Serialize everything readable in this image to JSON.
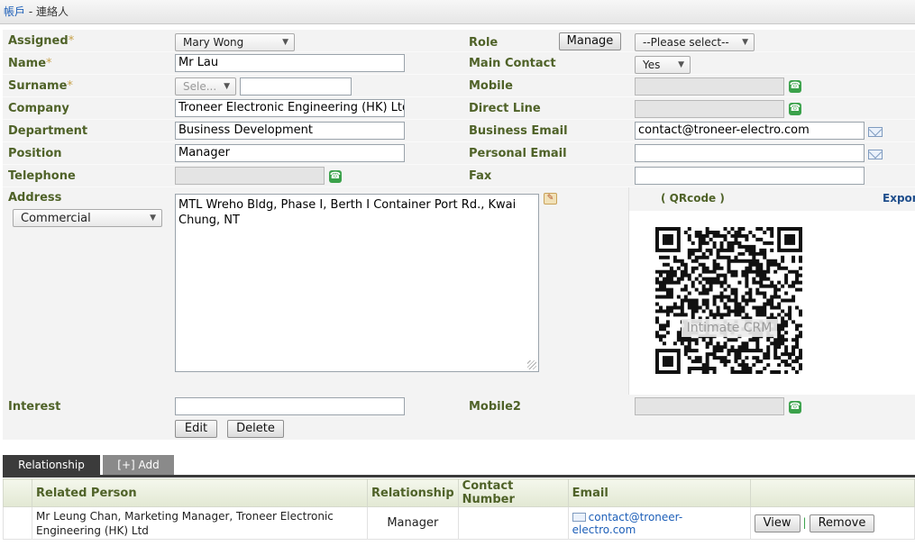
{
  "breadcrumb": {
    "root": "帳戶",
    "separator": " - ",
    "current": "連絡人"
  },
  "form": {
    "assigned": {
      "label": "Assigned",
      "required": "*",
      "value": "Mary Wong"
    },
    "role": {
      "label": "Role",
      "button": "Manage",
      "value": "--Please select--"
    },
    "name": {
      "label": "Name",
      "required": "*",
      "value": "Mr Lau"
    },
    "main_contact": {
      "label": "Main Contact",
      "value": "Yes"
    },
    "surname": {
      "label": "Surname",
      "required": "*",
      "select_value": "Sele...",
      "value": ""
    },
    "mobile": {
      "label": "Mobile",
      "value": ""
    },
    "company": {
      "label": "Company",
      "value": "Troneer Electronic Engineering (HK) Ltd"
    },
    "direct_line": {
      "label": "Direct Line",
      "value": ""
    },
    "department": {
      "label": "Department",
      "value": "Business Development"
    },
    "business_email": {
      "label": "Business Email",
      "value": "contact@troneer-electro.com"
    },
    "position": {
      "label": "Position",
      "value": "Manager"
    },
    "personal_email": {
      "label": "Personal Email",
      "value": ""
    },
    "telephone": {
      "label": "Telephone",
      "value": ""
    },
    "fax": {
      "label": "Fax",
      "value": ""
    },
    "address": {
      "label": "Address",
      "type_value": "Commercial",
      "value": "MTL Wreho Bldg, Phase I, Berth I Container Port Rd., Kwai Chung, NT"
    },
    "interest": {
      "label": "Interest",
      "value": ""
    },
    "mobile2": {
      "label": "Mobile2",
      "value": ""
    },
    "edit_label": "Edit",
    "delete_label": "Delete"
  },
  "qr": {
    "title": "( QRcode )",
    "export_label": "Export",
    "watermark": "Intimate CRM"
  },
  "relationship": {
    "tab_label": "Relationship",
    "add_label": "[+] Add",
    "columns": [
      "Related Person",
      "Relationship",
      "Contact Number",
      "Email"
    ],
    "rows": [
      {
        "person": "Mr Leung Chan, Marketing Manager, Troneer Electronic Engineering (HK) Ltd",
        "relationship": "Manager",
        "contact_number": "",
        "email": "contact@troneer-electro.com",
        "view_label": "View",
        "separator": "|",
        "remove_label": "Remove"
      }
    ]
  },
  "icons": {
    "phone": "phone-icon",
    "email": "email-icon",
    "map": "map-icon",
    "dropdown": "chevron-down-icon"
  },
  "colors": {
    "label_green": "#4f6228",
    "link_blue": "#1d5fb8",
    "phone_green": "#3aa14a",
    "tab_dark": "#3b3b3b"
  }
}
